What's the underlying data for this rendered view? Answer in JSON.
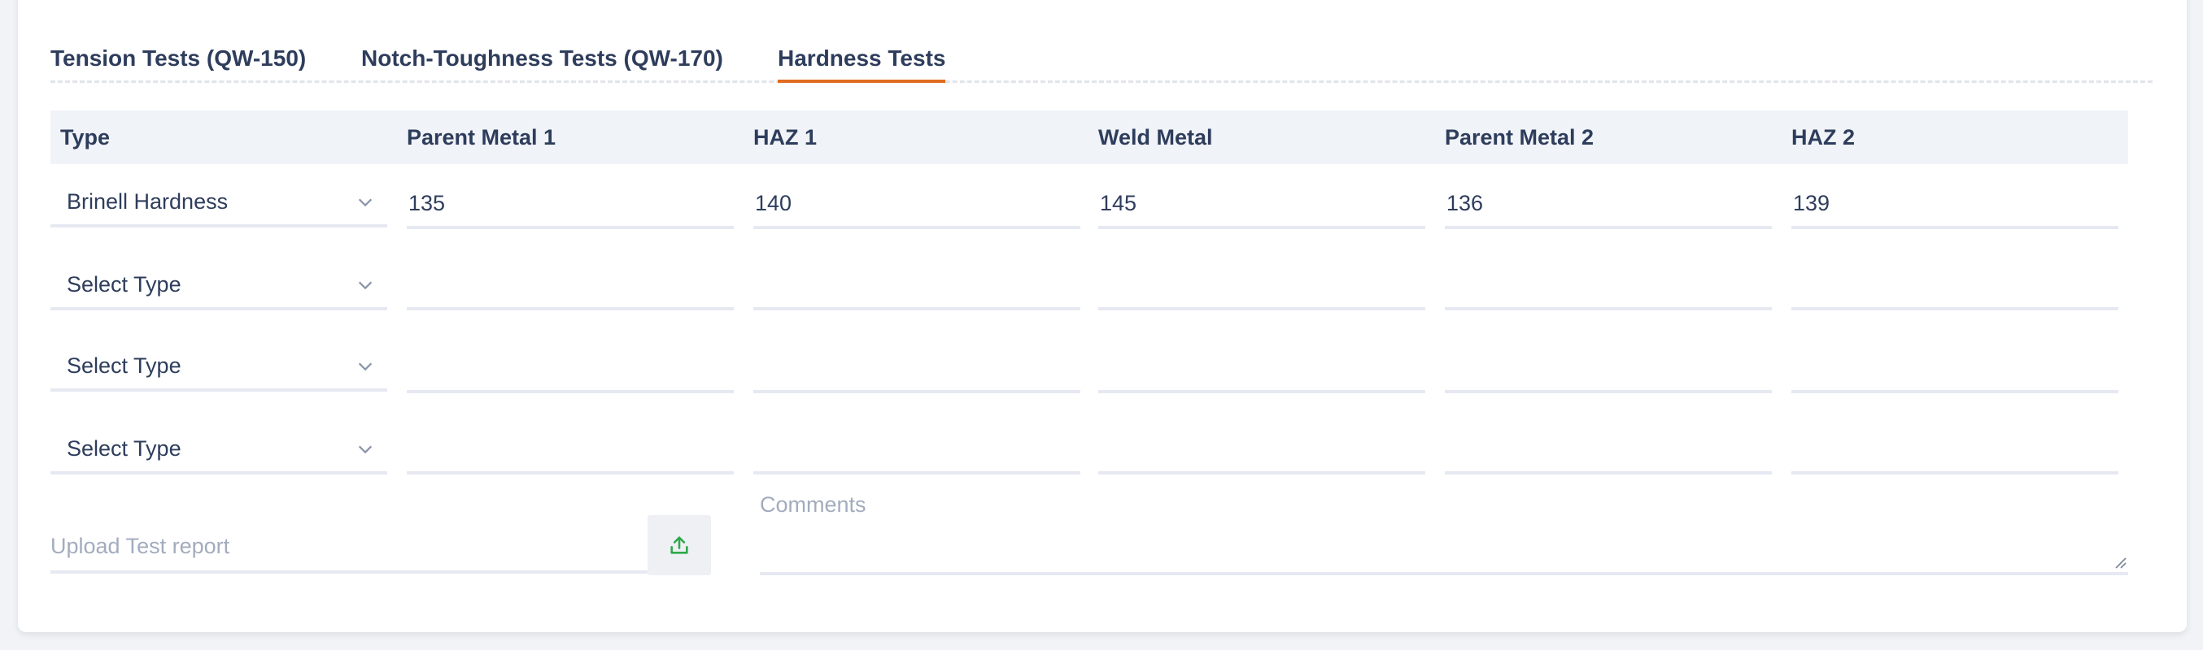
{
  "tabs": [
    {
      "label": "Tension Tests (QW-150)"
    },
    {
      "label": "Notch-Toughness Tests (QW-170)"
    },
    {
      "label": "Hardness Tests"
    }
  ],
  "active_tab": "Hardness Tests",
  "table": {
    "headers": [
      "Type",
      "Parent Metal 1",
      "HAZ 1",
      "Weld Metal",
      "Parent Metal 2",
      "HAZ 2"
    ],
    "rows": [
      {
        "type": "Brinell Hardness",
        "values": [
          "135",
          "140",
          "145",
          "136",
          "139"
        ]
      },
      {
        "type": "Select Type",
        "values": [
          "",
          "",
          "",
          "",
          ""
        ]
      },
      {
        "type": "Select Type",
        "values": [
          "",
          "",
          "",
          "",
          ""
        ]
      },
      {
        "type": "Select Type",
        "values": [
          "",
          "",
          "",
          "",
          ""
        ]
      }
    ]
  },
  "upload": {
    "placeholder": "Upload Test report",
    "icon": "upload-icon"
  },
  "comments": {
    "placeholder": "Comments"
  },
  "colors": {
    "accent": "#e06d1f",
    "upload_icon": "#2ea84a",
    "text": "#2e3d5c",
    "placeholder": "#a3acbe",
    "header_bg": "#f0f3f7"
  }
}
